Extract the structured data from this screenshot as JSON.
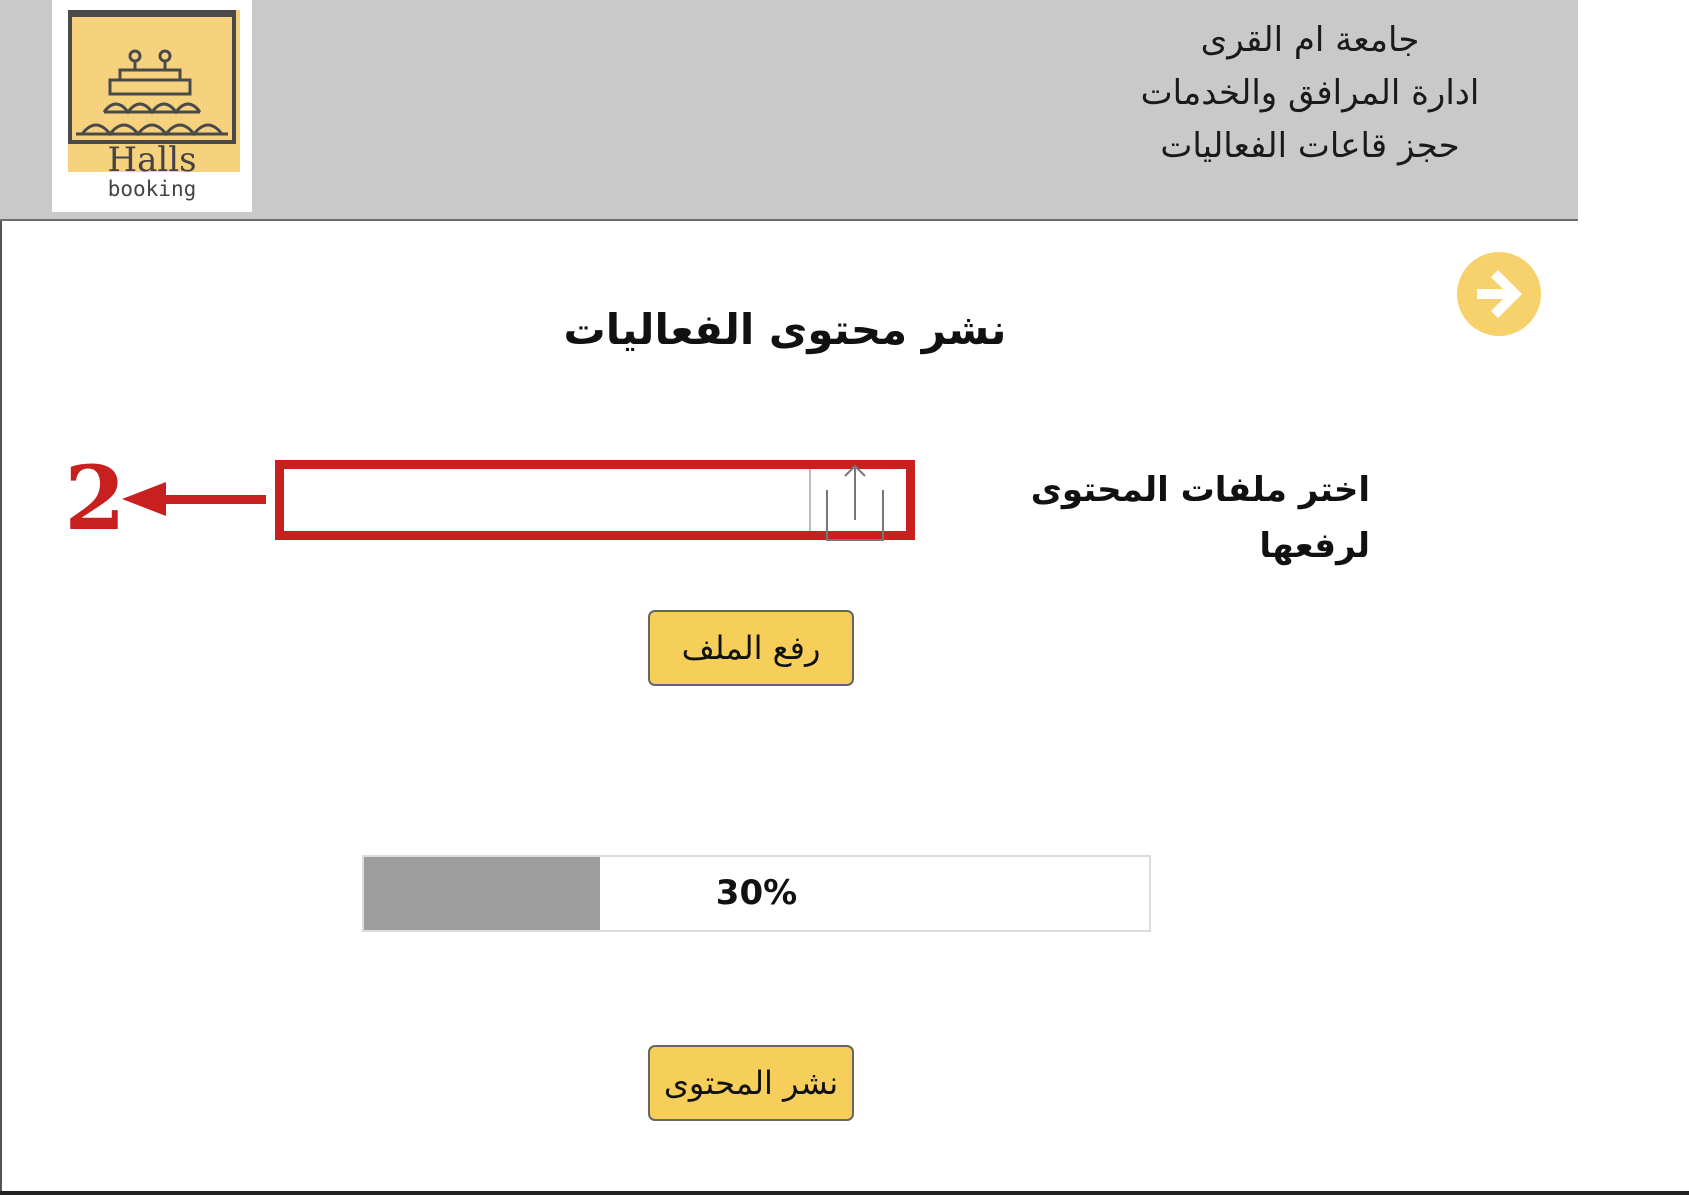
{
  "header": {
    "line1": "جامعة ام القرى",
    "line2": "ادارة المرافق والخدمات",
    "line3": "حجز قاعات الفعاليات",
    "logo_text_1": "Halls",
    "logo_text_2": "booking"
  },
  "nav": {
    "back_icon": "arrow-circle-right-icon",
    "accent_color": "#f7d16b"
  },
  "page": {
    "title": "نشر محتوى الفعاليات"
  },
  "upload": {
    "label": "اختر ملفات المحتوى لرفعها",
    "file_value": "",
    "upload_icon": "share-upload-icon",
    "upload_button": "رفع الملف"
  },
  "progress": {
    "value": 0.3,
    "label": "30%"
  },
  "publish": {
    "button": "نشر المحتوى"
  },
  "annotation": {
    "number": "2",
    "color": "#c8201e"
  }
}
